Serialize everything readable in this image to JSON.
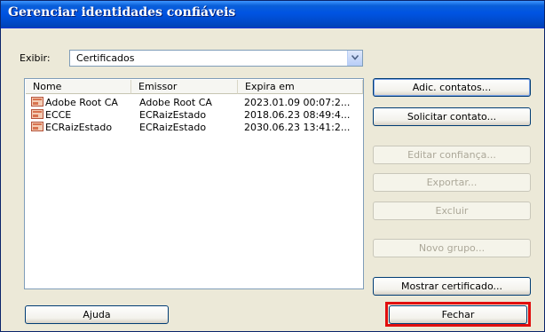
{
  "window": {
    "title": "Gerenciar identidades confiáveis"
  },
  "filter": {
    "label": "Exibir:",
    "value": "Certificados"
  },
  "table": {
    "columns": [
      "Nome",
      "Emissor",
      "Expira em"
    ],
    "rows": [
      {
        "name": "Adobe Root CA",
        "issuer": "Adobe Root CA",
        "expires": "2023.01.09 00:07:2..."
      },
      {
        "name": "ECCE",
        "issuer": "ECRaizEstado",
        "expires": "2018.06.23 08:49:4..."
      },
      {
        "name": "ECRaizEstado",
        "issuer": "ECRaizEstado",
        "expires": "2030.06.23 13:41:2..."
      }
    ]
  },
  "buttons": {
    "add_contacts": "Adic. contatos...",
    "request_contact": "Solicitar contato...",
    "edit_trust": "Editar confiança...",
    "export": "Exportar...",
    "delete": "Excluir",
    "new_group": "Novo grupo...",
    "show_certificate": "Mostrar certificado...",
    "help": "Ajuda",
    "close": "Fechar"
  },
  "icons": {
    "row_icon": "certificate-icon",
    "dropdown_icon": "chevron-down-icon"
  },
  "colors": {
    "titlebar": "#0054e3",
    "highlight": "#e10e0e",
    "window_bg": "#ece9d8"
  }
}
